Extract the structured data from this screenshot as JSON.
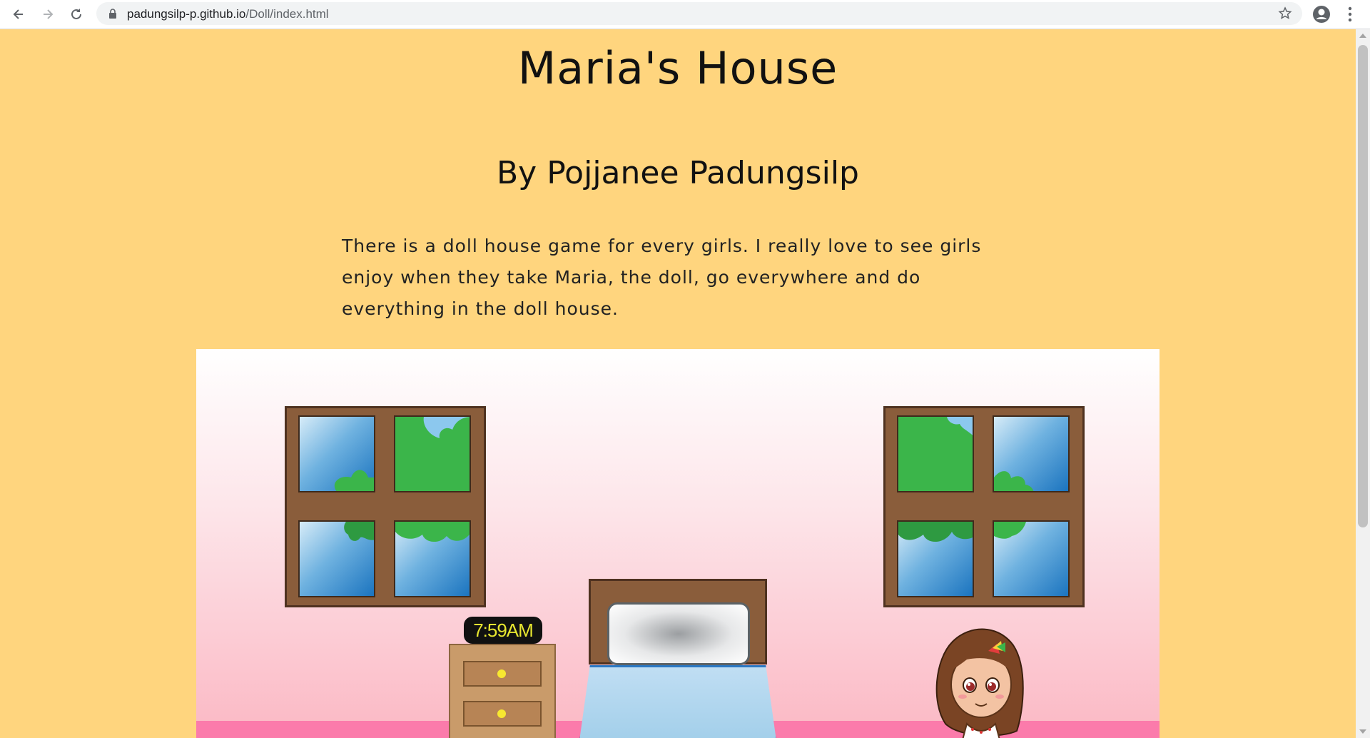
{
  "browser": {
    "url_host": "padungsilp-p.github.io",
    "url_path": "/Doll/index.html",
    "icons": [
      "back-arrow-icon",
      "forward-arrow-icon",
      "reload-icon",
      "lock-icon",
      "star-icon",
      "profile-icon",
      "menu-dots-icon"
    ]
  },
  "page": {
    "title": "Maria's House",
    "byline": "By Pojjanee Padungsilp",
    "intro": "There is a doll house game for every girls. I really love to see girls enjoy when they take Maria, the doll, go everywhere and do everything in the doll house."
  },
  "scene": {
    "clock_time": "7:59AM",
    "colors": {
      "background": "#ffd57e",
      "floor": "#fb7bab",
      "wood": "#8a5d3b",
      "tree_green": "#3bb54a",
      "clock_digits": "#e8e630"
    }
  }
}
